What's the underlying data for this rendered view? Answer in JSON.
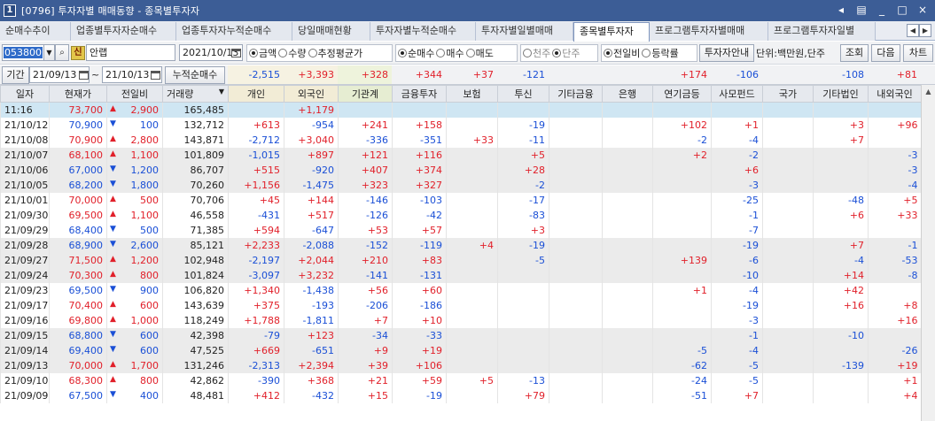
{
  "window": {
    "number": "1",
    "title": "[0796] 투자자별 매매동향 - 종목별투자자",
    "controls": [
      "◂",
      "▤",
      "_",
      "□",
      "×"
    ]
  },
  "tabs": [
    {
      "label": "순매수추이",
      "active": false
    },
    {
      "label": "업종별투자자순매수",
      "active": false
    },
    {
      "label": "업종투자자누적순매수",
      "active": false
    },
    {
      "label": "당일매매현황",
      "active": false
    },
    {
      "label": "투자자별누적순매수",
      "active": false
    },
    {
      "label": "투자자별일별매매",
      "active": false
    },
    {
      "label": "종목별투자자",
      "active": true
    },
    {
      "label": "프로그램투자자별매매",
      "active": false
    },
    {
      "label": "프로그램투자자일별",
      "active": false
    }
  ],
  "toolbar": {
    "stock_code": "053800",
    "credit_badge": "신",
    "stock_name": "안랩",
    "date": "2021/10/13",
    "unit_group": [
      {
        "label": "금액",
        "on": true
      },
      {
        "label": "수량",
        "on": false
      },
      {
        "label": "추정평균가",
        "on": false
      }
    ],
    "trade_group": [
      {
        "label": "순매수",
        "on": true
      },
      {
        "label": "매수",
        "on": false
      },
      {
        "label": "매도",
        "on": false
      }
    ],
    "share_group": [
      {
        "label": "천주",
        "on": false,
        "dim": true
      },
      {
        "label": "단주",
        "on": true,
        "dim": true
      }
    ],
    "compare_group": [
      {
        "label": "전일비",
        "on": true
      },
      {
        "label": "등락률",
        "on": false
      }
    ],
    "guide_button": "투자자안내",
    "unit_text": "단위:백만원,단주",
    "query_button": "조회",
    "next_button": "다음",
    "chart_button": "차트"
  },
  "period": {
    "label": "기간",
    "from": "21/09/13",
    "to": "21/10/13",
    "tilde": "~",
    "cumulative_label": "누적순매수"
  },
  "summary": [
    "-2,515",
    "+3,393",
    "+328",
    "+344",
    "+37",
    "-121",
    "",
    "",
    "+174",
    "-106",
    "",
    "-108",
    "+81"
  ],
  "headers": [
    "일자",
    "현재가",
    "전일비",
    "거래량",
    "개인",
    "외국인",
    "기관계",
    "금융투자",
    "보험",
    "투신",
    "기타금융",
    "은행",
    "연기금등",
    "사모펀드",
    "국가",
    "기타법인",
    "내외국인"
  ],
  "rows": [
    {
      "date": "11:16",
      "price": "73,700",
      "dir": "up",
      "chg": "2,900",
      "vol": "165,485",
      "vals": [
        "",
        "+1,179",
        "",
        "",
        "",
        "",
        "",
        "",
        "",
        "",
        "",
        "",
        ""
      ],
      "bg": "live"
    },
    {
      "date": "21/10/12",
      "price": "70,900",
      "dir": "dn",
      "chg": "100",
      "vol": "132,712",
      "vals": [
        "+613",
        "-954",
        "+241",
        "+158",
        "",
        "-19",
        "",
        "",
        "+102",
        "+1",
        "",
        "+3",
        "+96"
      ],
      "bg": "white"
    },
    {
      "date": "21/10/08",
      "price": "70,900",
      "dir": "up",
      "chg": "2,800",
      "vol": "143,871",
      "vals": [
        "-2,712",
        "+3,040",
        "-336",
        "-351",
        "+33",
        "-11",
        "",
        "",
        "-2",
        "-4",
        "",
        "+7",
        ""
      ],
      "bg": "white"
    },
    {
      "date": "21/10/07",
      "price": "68,100",
      "dir": "up",
      "chg": "1,100",
      "vol": "101,809",
      "vals": [
        "-1,015",
        "+897",
        "+121",
        "+116",
        "",
        "+5",
        "",
        "",
        "+2",
        "-2",
        "",
        "",
        "-3"
      ],
      "bg": "grey"
    },
    {
      "date": "21/10/06",
      "price": "67,000",
      "dir": "dn",
      "chg": "1,200",
      "vol": "86,707",
      "vals": [
        "+515",
        "-920",
        "+407",
        "+374",
        "",
        "+28",
        "",
        "",
        "",
        "+6",
        "",
        "",
        "-3"
      ],
      "bg": "grey"
    },
    {
      "date": "21/10/05",
      "price": "68,200",
      "dir": "dn",
      "chg": "1,800",
      "vol": "70,260",
      "vals": [
        "+1,156",
        "-1,475",
        "+323",
        "+327",
        "",
        "-2",
        "",
        "",
        "",
        "-3",
        "",
        "",
        "-4"
      ],
      "bg": "grey"
    },
    {
      "date": "21/10/01",
      "price": "70,000",
      "dir": "up",
      "chg": "500",
      "vol": "70,706",
      "vals": [
        "+45",
        "+144",
        "-146",
        "-103",
        "",
        "-17",
        "",
        "",
        "",
        "-25",
        "",
        "-48",
        "+5"
      ],
      "bg": "white"
    },
    {
      "date": "21/09/30",
      "price": "69,500",
      "dir": "up",
      "chg": "1,100",
      "vol": "46,558",
      "vals": [
        "-431",
        "+517",
        "-126",
        "-42",
        "",
        "-83",
        "",
        "",
        "",
        "-1",
        "",
        "+6",
        "+33"
      ],
      "bg": "white"
    },
    {
      "date": "21/09/29",
      "price": "68,400",
      "dir": "dn",
      "chg": "500",
      "vol": "71,385",
      "vals": [
        "+594",
        "-647",
        "+53",
        "+57",
        "",
        "+3",
        "",
        "",
        "",
        "-7",
        "",
        "",
        ""
      ],
      "bg": "white"
    },
    {
      "date": "21/09/28",
      "price": "68,900",
      "dir": "dn",
      "chg": "2,600",
      "vol": "85,121",
      "vals": [
        "+2,233",
        "-2,088",
        "-152",
        "-119",
        "+4",
        "-19",
        "",
        "",
        "",
        "-19",
        "",
        "+7",
        "-1"
      ],
      "bg": "grey"
    },
    {
      "date": "21/09/27",
      "price": "71,500",
      "dir": "up",
      "chg": "1,200",
      "vol": "102,948",
      "vals": [
        "-2,197",
        "+2,044",
        "+210",
        "+83",
        "",
        "-5",
        "",
        "",
        "+139",
        "-6",
        "",
        "-4",
        "-53"
      ],
      "bg": "grey"
    },
    {
      "date": "21/09/24",
      "price": "70,300",
      "dir": "up",
      "chg": "800",
      "vol": "101,824",
      "vals": [
        "-3,097",
        "+3,232",
        "-141",
        "-131",
        "",
        "",
        "",
        "",
        "",
        "-10",
        "",
        "+14",
        "-8"
      ],
      "bg": "grey"
    },
    {
      "date": "21/09/23",
      "price": "69,500",
      "dir": "dn",
      "chg": "900",
      "vol": "106,820",
      "vals": [
        "+1,340",
        "-1,438",
        "+56",
        "+60",
        "",
        "",
        "",
        "",
        "+1",
        "-4",
        "",
        "+42",
        ""
      ],
      "bg": "white"
    },
    {
      "date": "21/09/17",
      "price": "70,400",
      "dir": "up",
      "chg": "600",
      "vol": "143,639",
      "vals": [
        "+375",
        "-193",
        "-206",
        "-186",
        "",
        "",
        "",
        "",
        "",
        "-19",
        "",
        "+16",
        "+8"
      ],
      "bg": "white"
    },
    {
      "date": "21/09/16",
      "price": "69,800",
      "dir": "up",
      "chg": "1,000",
      "vol": "118,249",
      "vals": [
        "+1,788",
        "-1,811",
        "+7",
        "+10",
        "",
        "",
        "",
        "",
        "",
        "-3",
        "",
        "",
        "+16"
      ],
      "bg": "white"
    },
    {
      "date": "21/09/15",
      "price": "68,800",
      "dir": "dn",
      "chg": "600",
      "vol": "42,398",
      "vals": [
        "-79",
        "+123",
        "-34",
        "-33",
        "",
        "",
        "",
        "",
        "",
        "-1",
        "",
        "-10",
        ""
      ],
      "bg": "grey"
    },
    {
      "date": "21/09/14",
      "price": "69,400",
      "dir": "dn",
      "chg": "600",
      "vol": "47,525",
      "vals": [
        "+669",
        "-651",
        "+9",
        "+19",
        "",
        "",
        "",
        "",
        "-5",
        "-4",
        "",
        "",
        "-26"
      ],
      "bg": "grey"
    },
    {
      "date": "21/09/13",
      "price": "70,000",
      "dir": "up",
      "chg": "1,700",
      "vol": "131,246",
      "vals": [
        "-2,313",
        "+2,394",
        "+39",
        "+106",
        "",
        "",
        "",
        "",
        "-62",
        "-5",
        "",
        "-139",
        "+19"
      ],
      "bg": "grey"
    },
    {
      "date": "21/09/10",
      "price": "68,300",
      "dir": "up",
      "chg": "800",
      "vol": "42,862",
      "vals": [
        "-390",
        "+368",
        "+21",
        "+59",
        "+5",
        "-13",
        "",
        "",
        "-24",
        "-5",
        "",
        "",
        "+1"
      ],
      "bg": "white"
    },
    {
      "date": "21/09/09",
      "price": "67,500",
      "dir": "dn",
      "chg": "400",
      "vol": "48,481",
      "vals": [
        "+412",
        "-432",
        "+15",
        "-19",
        "",
        "+79",
        "",
        "",
        "-51",
        "+7",
        "",
        "",
        "+4"
      ],
      "bg": "white"
    }
  ],
  "colors": {
    "up": "#e1202a",
    "down": "#1a4fd6",
    "titlebar": "#3c5d96",
    "live_row": "#cfe6f3",
    "grey_row": "#ebebeb"
  }
}
